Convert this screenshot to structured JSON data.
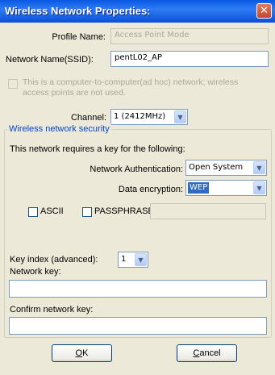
{
  "window": {
    "title": "Wireless Network Properties:"
  },
  "profile": {
    "label": "Profile Name:",
    "value": "Access Point Mode"
  },
  "ssid": {
    "label": "Network Name(SSID):",
    "value": "pentL02_AP"
  },
  "adhoc": {
    "label": "This is a computer-to-computer(ad hoc) network; wireless access points are not used."
  },
  "channel": {
    "label": "Channel:",
    "value": "1 (2412MHz)"
  },
  "security": {
    "group_label": "Wireless network security",
    "requires_label": "This network requires a key for the following:",
    "auth_label": "Network Authentication:",
    "auth_value": "Open System",
    "enc_label": "Data encryption:",
    "enc_value": "WEP",
    "ascii_label": "ASCII",
    "passphrase_label": "PASSPHRASE",
    "passphrase_value": "",
    "keyindex_label": "Key index (advanced):",
    "keyindex_value": "1",
    "netkey_label": "Network key:",
    "netkey_value": "",
    "confirm_label": "Confirm network key:",
    "confirm_value": ""
  },
  "buttons": {
    "ok_mnemonic": "O",
    "ok_rest": "K",
    "cancel_mnemonic": "C",
    "cancel_rest": "ancel"
  }
}
